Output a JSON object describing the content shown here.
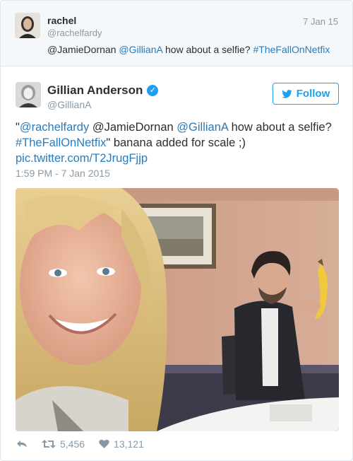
{
  "parent_tweet": {
    "name": "rachel",
    "handle": "@rachelfardy",
    "date": "7 Jan 15",
    "text_mention": "@JamieDornan",
    "text_link_mention": "@GillianA",
    "text_body": " how about a selfie? ",
    "text_hashtag": "#TheFallOnNetfix"
  },
  "tweet": {
    "name": "Gillian Anderson",
    "handle": "@GillianA",
    "follow_label": "Follow",
    "line1_quote_open": "\"",
    "line1_link": "@rachelfardy",
    "line1_plain": " @JamieDornan ",
    "line1_link2": "@GillianA",
    "line1_rest": " how about a selfie?",
    "line2_hashtag": "#TheFallOnNetfix",
    "line2_rest": "\" banana added for scale ;)",
    "line3_link": "pic.twitter.com/T2JrugFjjp",
    "timestamp": "1:59 PM - 7 Jan 2015"
  },
  "actions": {
    "retweets": "5,456",
    "likes": "13,121"
  },
  "icons": {
    "verified": "verified-badge-icon",
    "follow_bird": "twitter-bird-icon",
    "reply": "reply-icon",
    "retweet": "retweet-icon",
    "like": "heart-icon"
  },
  "colors": {
    "link": "#2b7bb9",
    "accent": "#1da1f2",
    "muted": "#8899a6",
    "text": "#292f33"
  }
}
